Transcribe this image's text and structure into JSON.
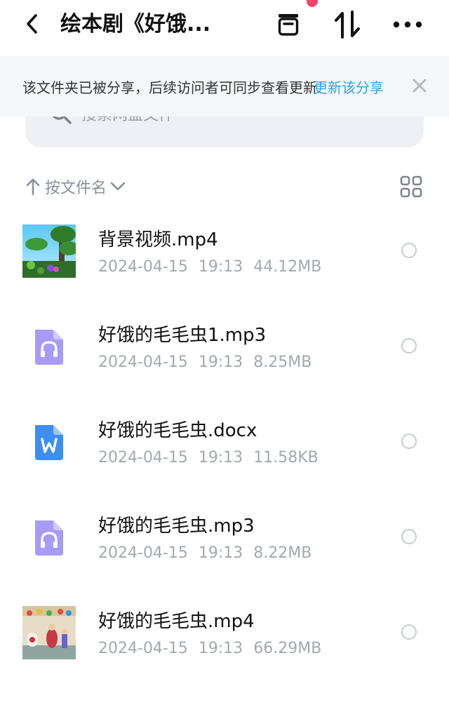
{
  "header": {
    "title": "绘本剧《好饿...",
    "icons": [
      "back-arrow-icon",
      "archive-box-icon",
      "sort-arrows-icon",
      "more-dots-icon"
    ]
  },
  "notice": {
    "text": "该文件夹已被分享，后续访问者可同步查看更新",
    "link": "更新该分享",
    "close_icon": "close-x-icon"
  },
  "search": {
    "placeholder": "搜索网盘文件"
  },
  "sort": {
    "label": "按文件名",
    "icons": [
      "up-arrow-icon",
      "chevron-down-icon",
      "grid-view-icon"
    ]
  },
  "files": [
    {
      "name": "背景视频.mp4",
      "date": "2024-04-15",
      "time": "19:13",
      "size": "44.12MB",
      "icon": "video-thumbnail-forest"
    },
    {
      "name": "好饿的毛毛虫1.mp3",
      "date": "2024-04-15",
      "time": "19:13",
      "size": "8.25MB",
      "icon": "audio-file-icon"
    },
    {
      "name": "好饿的毛毛虫.docx",
      "date": "2024-04-15",
      "time": "19:13",
      "size": "11.58KB",
      "icon": "word-file-icon"
    },
    {
      "name": "好饿的毛毛虫.mp3",
      "date": "2024-04-15",
      "time": "19:13",
      "size": "8.22MB",
      "icon": "audio-file-icon"
    },
    {
      "name": "好饿的毛毛虫.mp4",
      "date": "2024-04-15",
      "time": "19:13",
      "size": "66.29MB",
      "icon": "video-thumbnail-stage"
    }
  ],
  "colors": {
    "accent_link": "#2fa2e8",
    "notice_bg": "#f5f6f8",
    "search_bg": "#eef0f5",
    "audio_icon": "#a79cf5",
    "word_icon": "#3d8ef0",
    "badge_red": "#f04667"
  }
}
